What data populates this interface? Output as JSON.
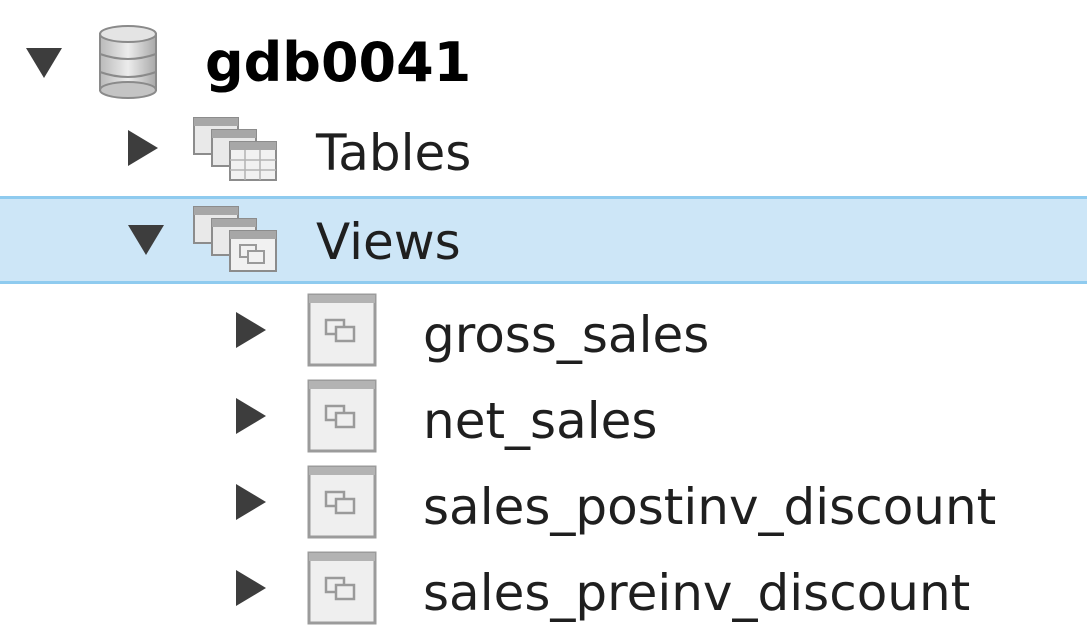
{
  "tree": {
    "database": {
      "name": "gdb0041",
      "icon": "database-icon",
      "expanded": true
    },
    "folders": [
      {
        "label": "Tables",
        "icon": "tables-folder-icon",
        "expanded": false,
        "selected": false
      },
      {
        "label": "Views",
        "icon": "views-folder-icon",
        "expanded": true,
        "selected": true
      }
    ],
    "views": [
      {
        "label": "gross_sales",
        "icon": "view-icon"
      },
      {
        "label": "net_sales",
        "icon": "view-icon"
      },
      {
        "label": "sales_postinv_discount",
        "icon": "view-icon"
      },
      {
        "label": "sales_preinv_discount",
        "icon": "view-icon"
      }
    ]
  },
  "colors": {
    "selection_fill": "#cde6f7",
    "selection_border": "#8fcbef",
    "arrow": "#3d3d3d"
  }
}
